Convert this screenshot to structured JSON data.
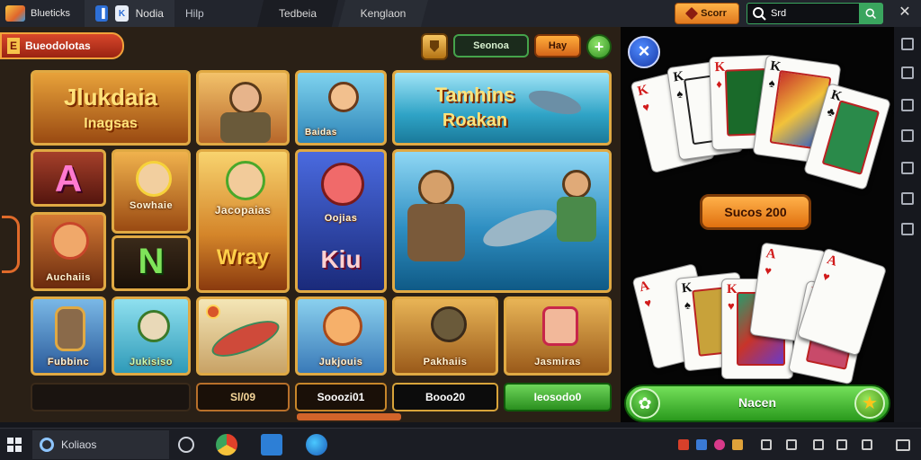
{
  "window": {
    "app_name": "Blueticks",
    "tabs": [
      {
        "label": "Nodia",
        "icon": "app-tile-icon"
      },
      {
        "label": "Hilp"
      },
      {
        "label": "Tedbeia"
      },
      {
        "label": "Kenglaon"
      }
    ],
    "score_label": "Scorr",
    "search_value": "Srd",
    "colors": {
      "accent": "#3aa55e",
      "topbar": "#22252d"
    }
  },
  "game": {
    "tab_label": "Bueodolotas",
    "tab_icon_glyph": "E",
    "header": {
      "pill_dark": "Seonoa",
      "pill_orange": "Hay",
      "plus_glyph": "+"
    },
    "tiles": [
      {
        "title": "Jlukdaia",
        "subtitle": "Inagsas"
      },
      {
        "caption": ""
      },
      {
        "caption": "Baidas"
      },
      {
        "title": "Tamhins",
        "subtitle": "Roakan"
      },
      {
        "glyph": "A"
      },
      {
        "caption": "Sowhaie"
      },
      {
        "caption": "Jacopaias",
        "subtitle": "Wray"
      },
      {
        "caption": "Oojias",
        "subtitle": "Kiu"
      },
      {
        "caption": ""
      },
      {
        "caption": "Auchaiis"
      },
      {
        "glyph": "N"
      },
      {
        "caption": "Fubbinc"
      },
      {
        "caption": "Jukisiso"
      },
      {
        "caption": ""
      },
      {
        "caption": "Jukjouis"
      },
      {
        "caption": "Pakhaiis"
      },
      {
        "caption": "Jasmiras"
      }
    ],
    "bottom_slots": [
      "",
      "Sl/09",
      "Sooozi01",
      "Booo20",
      "Ieosodo0"
    ]
  },
  "cards": {
    "close_glyph": "×",
    "top_hand": [
      {
        "rank": "K",
        "suit": "♥",
        "color": "red"
      },
      {
        "rank": "K",
        "suit": "♠",
        "color": "black"
      },
      {
        "rank": "K",
        "suit": "♦",
        "color": "red"
      },
      {
        "rank": "K",
        "suit": "♠",
        "color": "black"
      },
      {
        "rank": "K",
        "suit": "♣",
        "color": "black"
      },
      {
        "rank": "K",
        "suit": "♠",
        "color": "black"
      }
    ],
    "win_label": "Sucos 200",
    "bottom_hand": [
      {
        "rank": "A",
        "suit": "♥",
        "color": "red"
      },
      {
        "rank": "K",
        "suit": "♠",
        "color": "black"
      },
      {
        "rank": "K",
        "suit": "♥",
        "color": "red"
      },
      {
        "rank": "A",
        "suit": "♥",
        "color": "red"
      },
      {
        "rank": "K",
        "suit": "♥",
        "color": "red"
      },
      {
        "rank": "A",
        "suit": "♥",
        "color": "red"
      }
    ],
    "place_label": "Nacen",
    "place_left_glyph": "✿",
    "place_right_glyph": "★"
  },
  "taskbar": {
    "search_label": "Koliaos",
    "apps": [
      "circle-icon",
      "chrome-icon",
      "folder-icon",
      "edge-icon"
    ]
  }
}
